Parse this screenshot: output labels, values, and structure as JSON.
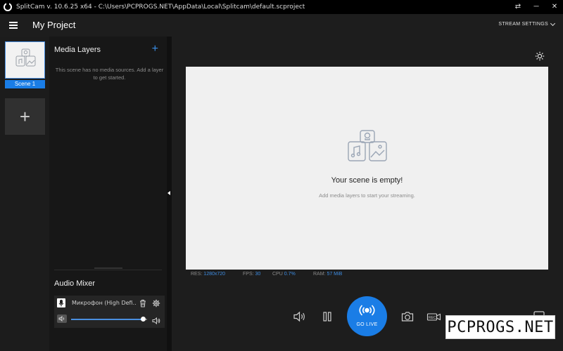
{
  "window": {
    "title": "SplitCam v. 10.6.25 x64 - C:\\Users\\PCPROGS.NET\\AppData\\Local\\Splitcam\\default.scproject",
    "controls": [
      "⇄",
      "─",
      "✕"
    ]
  },
  "header": {
    "project_title": "My Project",
    "stream_settings_label": "STREAM SETTINGS"
  },
  "scenes": {
    "items": [
      {
        "label": "Scene 1",
        "selected": true
      }
    ],
    "add_label": "+"
  },
  "layers": {
    "title": "Media Layers",
    "add_label": "+",
    "empty_text": "This scene has no media sources. Add a layer to get started."
  },
  "audio_mixer": {
    "title": "Audio Mixer",
    "source_name": "Микрофон (High Defi...",
    "volume_fraction": 0.95
  },
  "canvas": {
    "empty_title": "Your scene is empty!",
    "empty_subtitle": "Add media layers to start your streaming."
  },
  "stats": {
    "res_label": "RES:",
    "res_value": "1280x720",
    "fps_label": "FPS:",
    "fps_value": "30",
    "cpu_label": "CPU",
    "cpu_value": "0.7%",
    "ram_label": "RAM:",
    "ram_value": "57 MiB"
  },
  "toolbar": {
    "go_live_label": "GO LIVE",
    "icons": [
      "speaker-icon",
      "pause-icon",
      "broadcast-icon",
      "camera-icon",
      "record-icon",
      "chat-icon"
    ]
  },
  "watermark": "PCPROGS.NET",
  "colors": {
    "accent": "#1a7de6",
    "canvas_bg": "#f0f0f0",
    "app_bg": "#1b1b1b"
  }
}
